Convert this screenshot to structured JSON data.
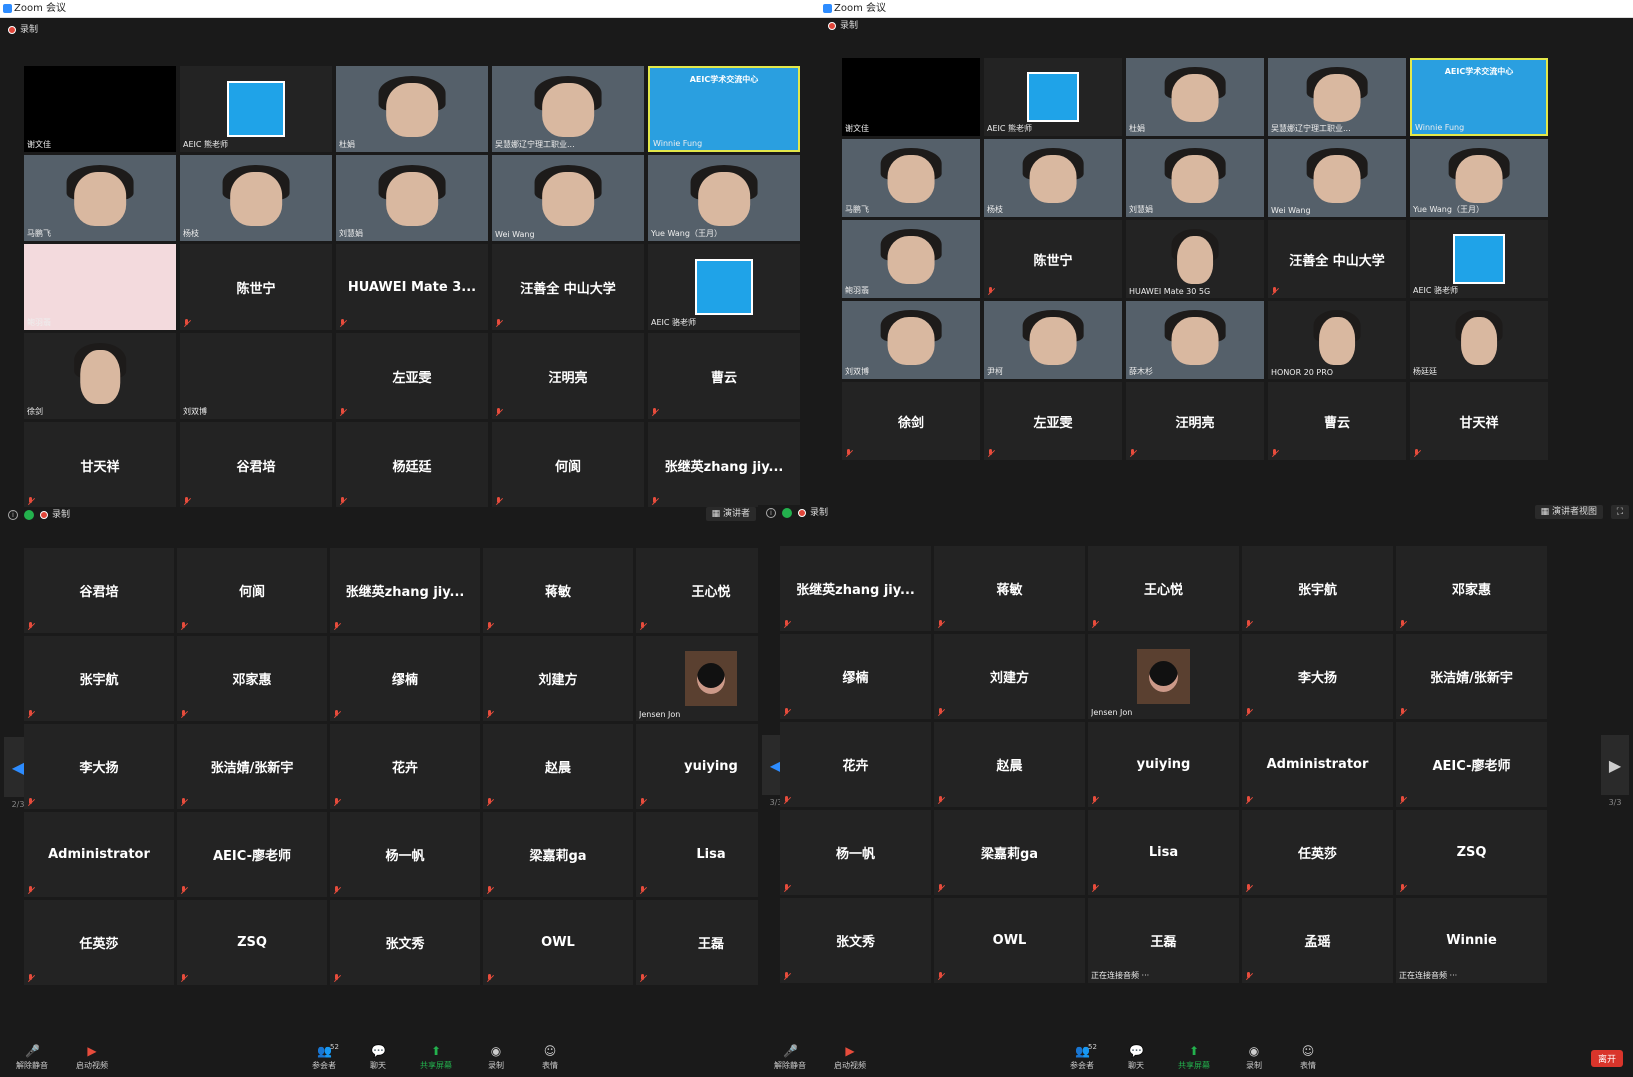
{
  "window_title": "Zoom 会议",
  "recording_label": "录制",
  "presenter_view_short": "演讲者",
  "presenter_view_label": "演讲者视图",
  "connecting_audio": "正在连接音频 ···",
  "leave_label": "离开",
  "panes": {
    "top_left": {
      "tiles": [
        {
          "label": "谢文佳",
          "kind": "black"
        },
        {
          "label": "AEIC 熊老师",
          "kind": "aeic"
        },
        {
          "label": "杜娟",
          "kind": "video"
        },
        {
          "label": "吴慧娜辽宁理工职业...",
          "kind": "video"
        },
        {
          "label": "Winnie Fung",
          "kind": "aeic-video",
          "active": true,
          "banner": "AEIC学术交流中心"
        },
        {
          "label": "马鹏飞",
          "kind": "video"
        },
        {
          "label": "杨枝",
          "kind": "video"
        },
        {
          "label": "刘慧娟",
          "kind": "video"
        },
        {
          "label": "Wei Wang",
          "kind": "video"
        },
        {
          "label": "Yue Wang（王月）",
          "kind": "video"
        },
        {
          "label": "鲍羽翡",
          "kind": "pink"
        },
        {
          "center": "陈世宁"
        },
        {
          "center": "HUAWEI Mate 3..."
        },
        {
          "center": "汪善全 中山大学"
        },
        {
          "label": "AEIC 骆老师",
          "kind": "aeic"
        },
        {
          "label": "徐剑",
          "kind": "video-small"
        },
        {
          "label": "刘双博",
          "kind": "empty"
        },
        {
          "center": "左亚雯"
        },
        {
          "center": "汪明亮"
        },
        {
          "center": "曹云"
        },
        {
          "center": "甘天祥"
        },
        {
          "center": "谷君培"
        },
        {
          "center": "杨廷廷"
        },
        {
          "center": "何阆"
        },
        {
          "center": "张继英zhang jiy..."
        }
      ]
    },
    "top_right": {
      "tiles": [
        {
          "label": "谢文佳",
          "kind": "black"
        },
        {
          "label": "AEIC 熊老师",
          "kind": "aeic"
        },
        {
          "label": "杜娟",
          "kind": "video"
        },
        {
          "label": "吴慧娜辽宁理工职业...",
          "kind": "video"
        },
        {
          "label": "Winnie Fung",
          "kind": "aeic-video",
          "active": true,
          "banner": "AEIC学术交流中心"
        },
        {
          "label": "马鹏飞",
          "kind": "video"
        },
        {
          "label": "杨枝",
          "kind": "video"
        },
        {
          "label": "刘慧娟",
          "kind": "video"
        },
        {
          "label": "Wei Wang",
          "kind": "video"
        },
        {
          "label": "Yue Wang（王月）",
          "kind": "video"
        },
        {
          "label": "鲍羽翡",
          "kind": "video"
        },
        {
          "center": "陈世宁"
        },
        {
          "label": "HUAWEI Mate 30 5G",
          "kind": "video-small"
        },
        {
          "center": "汪善全 中山大学"
        },
        {
          "label": "AEIC 骆老师",
          "kind": "aeic"
        },
        {
          "label": "刘双博",
          "kind": "video"
        },
        {
          "label": "尹柯",
          "kind": "video"
        },
        {
          "label": "薛木杉",
          "kind": "video"
        },
        {
          "label": "HONOR 20 PRO",
          "kind": "video-small"
        },
        {
          "label": "杨廷廷",
          "kind": "video-small"
        },
        {
          "center": "徐剑"
        },
        {
          "center": "左亚雯"
        },
        {
          "center": "汪明亮"
        },
        {
          "center": "曹云"
        },
        {
          "center": "甘天祥"
        }
      ]
    },
    "bottom_left": {
      "page": "2/3",
      "tiles": [
        {
          "center": "谷君培"
        },
        {
          "center": "何阆"
        },
        {
          "center": "张继英zhang jiy..."
        },
        {
          "center": "蒋敏"
        },
        {
          "center": "王心悦"
        },
        {
          "center": "张宇航"
        },
        {
          "center": "邓家惠"
        },
        {
          "center": "缪楠"
        },
        {
          "center": "刘建方"
        },
        {
          "label": "Jensen Jon",
          "kind": "avatar"
        },
        {
          "center": "李大扬"
        },
        {
          "center": "张洁婧/张新宇"
        },
        {
          "center": "花卉"
        },
        {
          "center": "赵晨"
        },
        {
          "center": "yuiying"
        },
        {
          "center": "Administrator"
        },
        {
          "center": "AEIC-廖老师"
        },
        {
          "center": "杨一帆"
        },
        {
          "center": "梁嘉莉ga"
        },
        {
          "center": "Lisa"
        },
        {
          "center": "任英莎"
        },
        {
          "center": "ZSQ"
        },
        {
          "center": "张文秀"
        },
        {
          "center": "OWL"
        },
        {
          "center": "王磊"
        }
      ]
    },
    "bottom_right": {
      "page": "3/3",
      "tiles": [
        {
          "center": "张继英zhang jiy..."
        },
        {
          "center": "蒋敏"
        },
        {
          "center": "王心悦"
        },
        {
          "center": "张宇航"
        },
        {
          "center": "邓家惠"
        },
        {
          "center": "缪楠"
        },
        {
          "center": "刘建方"
        },
        {
          "label": "Jensen Jon",
          "kind": "avatar"
        },
        {
          "center": "李大扬"
        },
        {
          "center": "张洁婧/张新宇"
        },
        {
          "center": "花卉"
        },
        {
          "center": "赵晨"
        },
        {
          "center": "yuiying"
        },
        {
          "center": "Administrator"
        },
        {
          "center": "AEIC-廖老师"
        },
        {
          "center": "杨一帆"
        },
        {
          "center": "梁嘉莉ga"
        },
        {
          "center": "Lisa"
        },
        {
          "center": "任英莎"
        },
        {
          "center": "ZSQ"
        },
        {
          "center": "张文秀"
        },
        {
          "center": "OWL"
        },
        {
          "center": "王磊",
          "connecting": true
        },
        {
          "center": "孟瑶"
        },
        {
          "center": "Winnie",
          "connecting": true
        }
      ]
    }
  },
  "toolbar": {
    "unmute": "解除静音",
    "start_video": "启动视频",
    "participants": "参会者",
    "participants_count": "52",
    "chat": "聊天",
    "share_screen": "共享屏幕",
    "record": "录制",
    "reactions": "表情"
  },
  "colors": {
    "background": "#1a1a1a",
    "tile": "#232323",
    "accent_blue": "#2d8cff",
    "share_green": "#23b14d",
    "leave_red": "#d9352b",
    "active_speaker": "#e3e84a"
  }
}
